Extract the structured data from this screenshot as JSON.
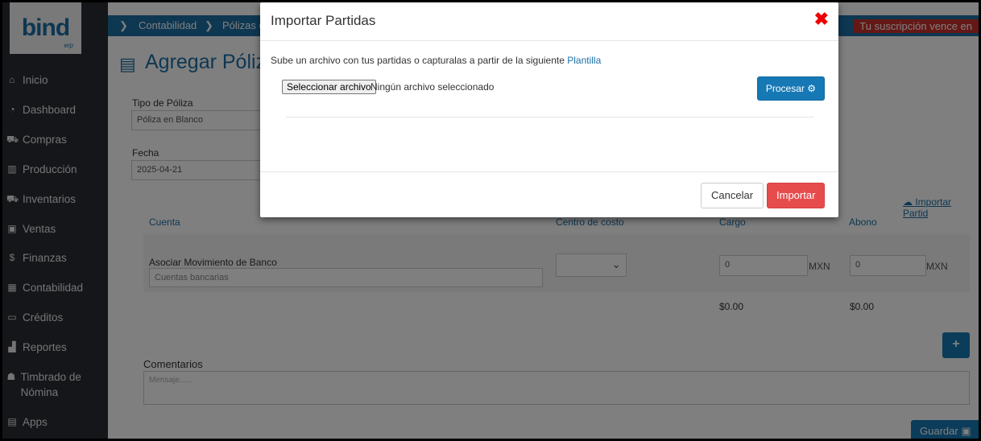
{
  "sidebar": {
    "logo": {
      "text": "bind",
      "sub": "erp"
    },
    "items": [
      {
        "icon": "home-icon",
        "glyph": "⌂",
        "label": "Inicio"
      },
      {
        "icon": "dashboard-icon",
        "glyph": "◔",
        "label": "Dashboard"
      },
      {
        "icon": "cart-icon",
        "glyph": "⛟",
        "label": "Compras"
      },
      {
        "icon": "factory-icon",
        "glyph": "▥",
        "label": "Producción"
      },
      {
        "icon": "truck-icon",
        "glyph": "⛟",
        "label": "Inventarios"
      },
      {
        "icon": "sales-icon",
        "glyph": "▣",
        "label": "Ventas"
      },
      {
        "icon": "dollar-icon",
        "glyph": "$",
        "label": "Finanzas"
      },
      {
        "icon": "calculator-icon",
        "glyph": "▦",
        "label": "Contabilidad"
      },
      {
        "icon": "credit-card-icon",
        "glyph": "▭",
        "label": "Créditos"
      },
      {
        "icon": "bar-chart-icon",
        "glyph": "▟",
        "label": "Reportes"
      },
      {
        "icon": "users-icon",
        "glyph": "☗",
        "label": "Timbrado de Nómina"
      },
      {
        "icon": "briefcase-icon",
        "glyph": "▤",
        "label": "Apps"
      }
    ]
  },
  "topbar": {
    "crumbs": [
      "Contabilidad",
      "Pólizas d"
    ],
    "subscription": "Tu suscripción vence en"
  },
  "page": {
    "title": "Agregar Póliza",
    "tipo_label": "Tipo de Póliza",
    "tipo_value": "Póliza en Blanco",
    "fecha_label": "Fecha",
    "fecha_value": "2025-04-21",
    "importar_link": "Importar Partid",
    "table": {
      "headers": [
        "Cuenta",
        "Centro de costo",
        "Cargo",
        "Abono"
      ],
      "row_label": "Asociar Movimiento de Banco",
      "cuentas_placeholder": "Cuentas bancarias",
      "cargo_value": "0",
      "abono_value": "0",
      "currency": "MXN",
      "cargo_total": "$0.00",
      "abono_total": "$0.00"
    },
    "comentarios_label": "Comentarios",
    "comentarios_placeholder": "Mensaje......",
    "guardar": "Guardar"
  },
  "modal": {
    "title": "Importar Partidas",
    "upload_text": "Sube un archivo con tus partidas o capturalas a partir de la siguiente",
    "upload_link": "Plantilla",
    "file_button": "Seleccionar archivo",
    "file_status": "Ningún archivo seleccionado",
    "procesar": "Procesar",
    "cancel": "Cancelar",
    "import": "Importar"
  },
  "colors": {
    "primary": "#1d6fa5",
    "danger": "#e74c4c",
    "sidebar": "#2a2d33",
    "close": "#e00000"
  }
}
